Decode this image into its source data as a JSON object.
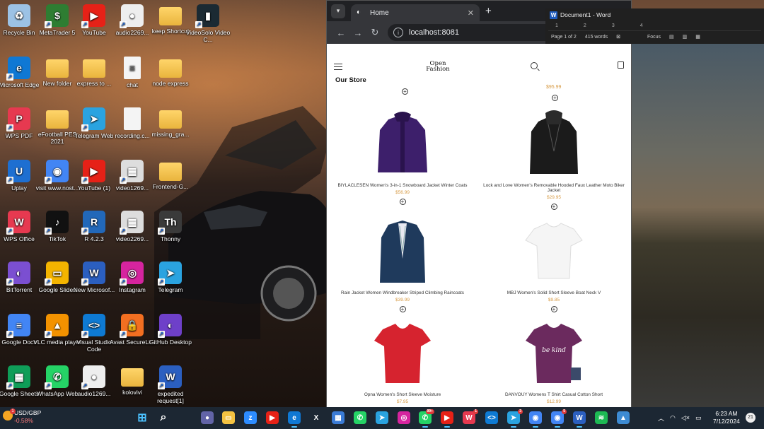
{
  "desktop": {
    "icons": [
      {
        "label": "Recycle Bin",
        "color": "#9cc2e5",
        "glyph": "♻"
      },
      {
        "label": "MetaTrader 5",
        "color": "#2e7d32",
        "glyph": "$"
      },
      {
        "label": "YouTube",
        "color": "#e62117",
        "glyph": "▶"
      },
      {
        "label": "audio2269...",
        "color": "#eeeeee",
        "glyph": "●"
      },
      {
        "label": "keep Shortcut",
        "color": "folder",
        "glyph": ""
      },
      {
        "label": "VideoSolo Video C...",
        "color": "#1b2a33",
        "glyph": "▮"
      },
      {
        "label": "Microsoft Edge",
        "color": "#0f78d4",
        "glyph": "e"
      },
      {
        "label": "New folder",
        "color": "folder",
        "glyph": ""
      },
      {
        "label": "express to ...",
        "color": "folder",
        "glyph": ""
      },
      {
        "label": "chat",
        "color": "doc",
        "glyph": "≡"
      },
      {
        "label": "node express",
        "color": "folder",
        "glyph": ""
      },
      {
        "label": "WPS PDF",
        "color": "#e63950",
        "glyph": "P"
      },
      {
        "label": "eFootball PES 2021",
        "color": "folder",
        "glyph": ""
      },
      {
        "label": "Telegram Web",
        "color": "#2aa3e0",
        "glyph": "➤"
      },
      {
        "label": "recording.c...",
        "color": "doc",
        "glyph": ""
      },
      {
        "label": "missing_gra...",
        "color": "folder",
        "glyph": ""
      },
      {
        "label": "Uplay",
        "color": "#1e6fd1",
        "glyph": "U"
      },
      {
        "label": "visit www.nost...",
        "color": "#4285f4",
        "glyph": "◉"
      },
      {
        "label": "YouTube (1)",
        "color": "#e62117",
        "glyph": "▶"
      },
      {
        "label": "video1269...",
        "color": "#dddddd",
        "glyph": "▦"
      },
      {
        "label": "Frontend-G...",
        "color": "folder",
        "glyph": ""
      },
      {
        "label": "WPS Office",
        "color": "#e63950",
        "glyph": "W"
      },
      {
        "label": "TikTok",
        "color": "#111111",
        "glyph": "♪"
      },
      {
        "label": "R 4.2.3",
        "color": "#2268b9",
        "glyph": "R"
      },
      {
        "label": "video2269...",
        "color": "#dddddd",
        "glyph": "▦"
      },
      {
        "label": "Thonny",
        "color": "#3a3a3a",
        "glyph": "Th"
      },
      {
        "label": "BitTorrent",
        "color": "#7b4fd1",
        "glyph": "◐"
      },
      {
        "label": "Google Slides",
        "color": "#f4b400",
        "glyph": "▭"
      },
      {
        "label": "New Microsof...",
        "color": "#2b5fc0",
        "glyph": "W"
      },
      {
        "label": "Instagram",
        "color": "#d6249f",
        "glyph": "◎"
      },
      {
        "label": "Telegram",
        "color": "#2aa3e0",
        "glyph": "➤"
      },
      {
        "label": "Google Docs",
        "color": "#4285f4",
        "glyph": "≡"
      },
      {
        "label": "VLC media player",
        "color": "#f39200",
        "glyph": "▲"
      },
      {
        "label": "Visual Studio Code",
        "color": "#0e7ad3",
        "glyph": "<>"
      },
      {
        "label": "Avast SecureLi...",
        "color": "#f36f21",
        "glyph": "🔒"
      },
      {
        "label": "GitHub Desktop",
        "color": "#6e40c9",
        "glyph": "◐"
      },
      {
        "label": "Google Sheets",
        "color": "#0f9d58",
        "glyph": "▦"
      },
      {
        "label": "WhatsApp Web",
        "color": "#25d366",
        "glyph": "✆"
      },
      {
        "label": "audio1269...",
        "color": "#eeeeee",
        "glyph": "●"
      },
      {
        "label": "kolovivi",
        "color": "folder",
        "glyph": ""
      },
      {
        "label": "expedited request[1]",
        "color": "#2b5fc0",
        "glyph": "W"
      }
    ]
  },
  "browser": {
    "tab_title": "Home",
    "new_tab": "+",
    "url": "localhost:8081"
  },
  "store": {
    "logo_line1": "Open",
    "logo_line2": "Fashion",
    "title": "Our Store",
    "cut_price": "$95.99",
    "products": [
      {
        "title": "BIYLACLESEN Women's 3-in-1 Snowboard Jacket Winter Coats",
        "price": "$56.99",
        "image": "purple-jacket"
      },
      {
        "title": "Lock and Love Women's Removable Hooded Faux Leather Moto Biker Jacket",
        "price": "$29.95",
        "image": "black-leather-jacket"
      },
      {
        "title": "Rain Jacket Women Windbreaker Striped Climbing Raincoats",
        "price": "$39.99",
        "image": "navy-raincoat"
      },
      {
        "title": "MBJ Women's Solid Short Sleeve Boat Neck V",
        "price": "$9.85",
        "image": "white-top"
      },
      {
        "title": "Opna Women's Short Sleeve Moisture",
        "price": "$7.95",
        "image": "red-tshirt"
      },
      {
        "title": "DANVOUY Womens T Shirt Casual Cotton Short",
        "price": "$12.99",
        "image": "purple-tshirt"
      }
    ]
  },
  "word": {
    "title": "Document1 - Word",
    "page_info": "Page 1 of 2",
    "word_count": "415 words",
    "focus": "Focus",
    "ruler": [
      "1",
      "2",
      "3",
      "4"
    ]
  },
  "taskbar": {
    "ticker_pair": "USD/GBP",
    "ticker_change": "-0.58%",
    "ticker_badge": "1",
    "time": "6:23 AM",
    "date": "7/12/2024",
    "notifications": "21",
    "apps": [
      {
        "name": "start",
        "color": "#4cc2ff",
        "glyph": "⊞",
        "badge": ""
      },
      {
        "name": "search",
        "color": "#1c2733",
        "glyph": "⌕",
        "badge": ""
      },
      {
        "name": "meet",
        "color": "#6264a7",
        "glyph": "●",
        "badge": ""
      },
      {
        "name": "file-explorer",
        "color": "#f3c242",
        "glyph": "▭",
        "badge": ""
      },
      {
        "name": "zoom",
        "color": "#2d8cff",
        "glyph": "z",
        "badge": ""
      },
      {
        "name": "youtube",
        "color": "#e62117",
        "glyph": "▶",
        "badge": ""
      },
      {
        "name": "edge",
        "color": "#0f78d4",
        "glyph": "e",
        "badge": ""
      },
      {
        "name": "x",
        "color": "#000000",
        "glyph": "X",
        "badge": ""
      },
      {
        "name": "store",
        "color": "#3a7bd5",
        "glyph": "▦",
        "badge": ""
      },
      {
        "name": "whatsapp",
        "color": "#25d366",
        "glyph": "✆",
        "badge": ""
      },
      {
        "name": "telegram",
        "color": "#2aa3e0",
        "glyph": "➤",
        "badge": ""
      },
      {
        "name": "instagram",
        "color": "#d6249f",
        "glyph": "◎",
        "badge": ""
      },
      {
        "name": "whatsapp-2",
        "color": "#25d366",
        "glyph": "✆",
        "badge": "99+"
      },
      {
        "name": "youtube-2",
        "color": "#e62117",
        "glyph": "▶",
        "badge": ""
      },
      {
        "name": "wps",
        "color": "#e63950",
        "glyph": "W",
        "badge": "1"
      },
      {
        "name": "vscode",
        "color": "#0e7ad3",
        "glyph": "<>",
        "badge": ""
      },
      {
        "name": "telegram-2",
        "color": "#2aa3e0",
        "glyph": "➤",
        "badge": "3"
      },
      {
        "name": "chrome",
        "color": "#4285f4",
        "glyph": "◉",
        "badge": ""
      },
      {
        "name": "chrome-2",
        "color": "#4285f4",
        "glyph": "◉",
        "badge": "5"
      },
      {
        "name": "word",
        "color": "#2b5fc0",
        "glyph": "W",
        "badge": ""
      },
      {
        "name": "spotify",
        "color": "#1db954",
        "glyph": "≋",
        "badge": ""
      },
      {
        "name": "photos",
        "color": "#3d8bd3",
        "glyph": "▲",
        "badge": ""
      }
    ]
  }
}
